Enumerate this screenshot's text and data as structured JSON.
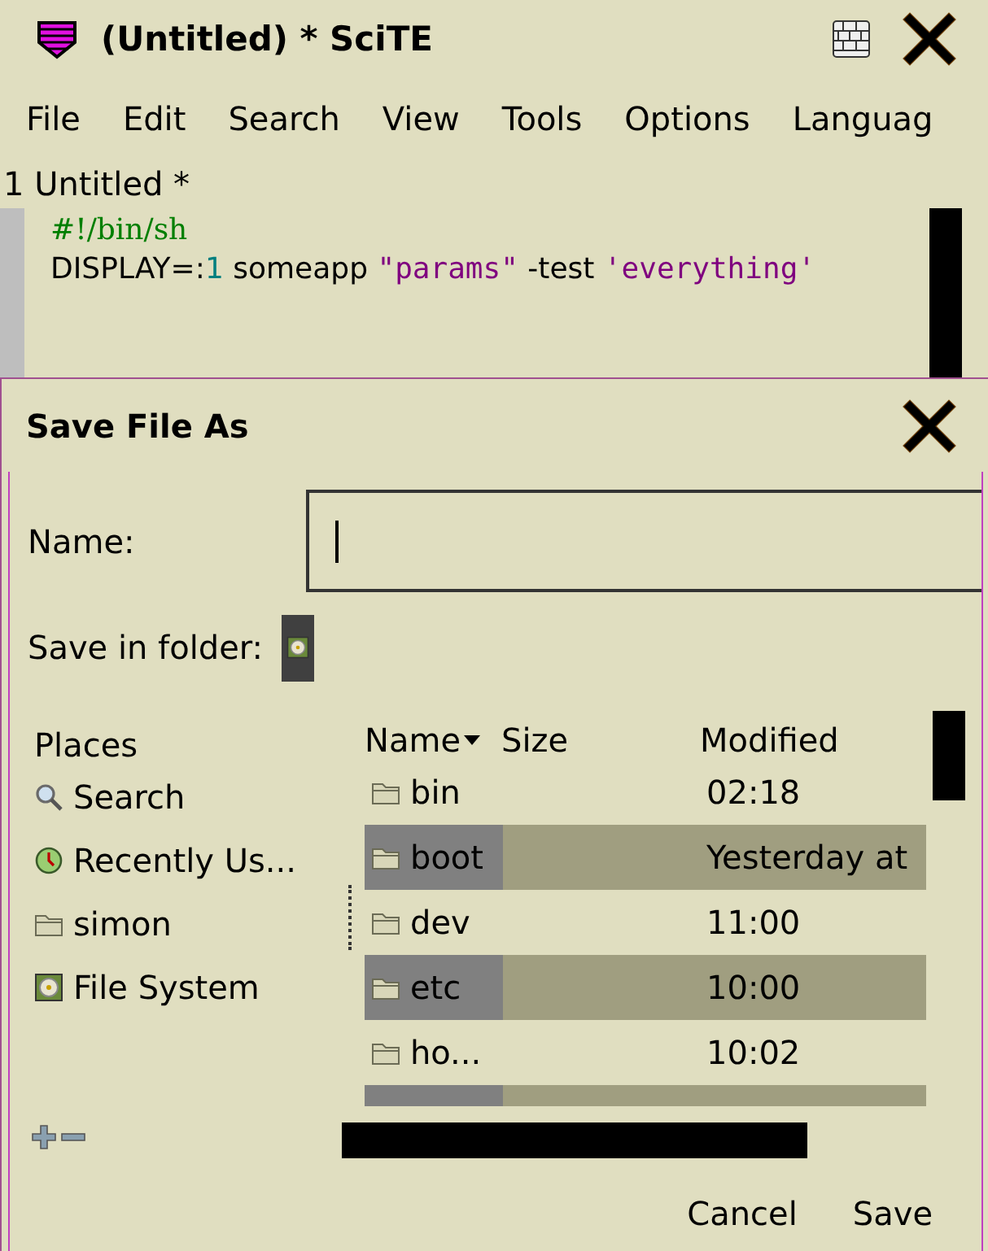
{
  "window": {
    "title": "(Untitled) * SciTE"
  },
  "menu": [
    {
      "label": "File"
    },
    {
      "label": "Edit"
    },
    {
      "label": "Search"
    },
    {
      "label": "View"
    },
    {
      "label": "Tools"
    },
    {
      "label": "Options"
    },
    {
      "label": "Languag"
    }
  ],
  "tabs": [
    {
      "label": "1 Untitled *",
      "selected": true
    }
  ],
  "editor": {
    "lines": [
      [
        {
          "kind": "comment",
          "text": "#!/bin/sh"
        }
      ],
      [
        {
          "kind": "plain",
          "text": "DISPLAY=:"
        },
        {
          "kind": "number",
          "text": "1"
        },
        {
          "kind": "plain",
          "text": " someapp "
        },
        {
          "kind": "string",
          "text": "\"params\""
        },
        {
          "kind": "plain",
          "text": " -test "
        },
        {
          "kind": "string",
          "text": "'everything'"
        }
      ]
    ]
  },
  "dialog": {
    "title": "Save File As",
    "name_label": "Name:",
    "folder_label": "Save in folder:",
    "places": {
      "heading": "Places",
      "items": [
        {
          "kind": "search",
          "label": "Search"
        },
        {
          "kind": "recent",
          "label": "Recently Us..."
        },
        {
          "kind": "folder",
          "label": "simon"
        },
        {
          "kind": "drive",
          "label": "File System"
        }
      ]
    },
    "columns": [
      {
        "label": "Name",
        "sorted": true
      },
      {
        "label": "Size",
        "sorted": false
      },
      {
        "label": "Modified",
        "sorted": false
      }
    ],
    "rows": [
      {
        "name": "bin",
        "modified": "02:18"
      },
      {
        "name": "boot",
        "modified": "Yesterday at"
      },
      {
        "name": "dev",
        "modified": "11:00"
      },
      {
        "name": "etc",
        "modified": "10:00"
      },
      {
        "name": "ho...",
        "modified": "10:02"
      },
      {}
    ],
    "buttons": [
      {
        "label": "Cancel"
      },
      {
        "label": "Save"
      }
    ]
  }
}
